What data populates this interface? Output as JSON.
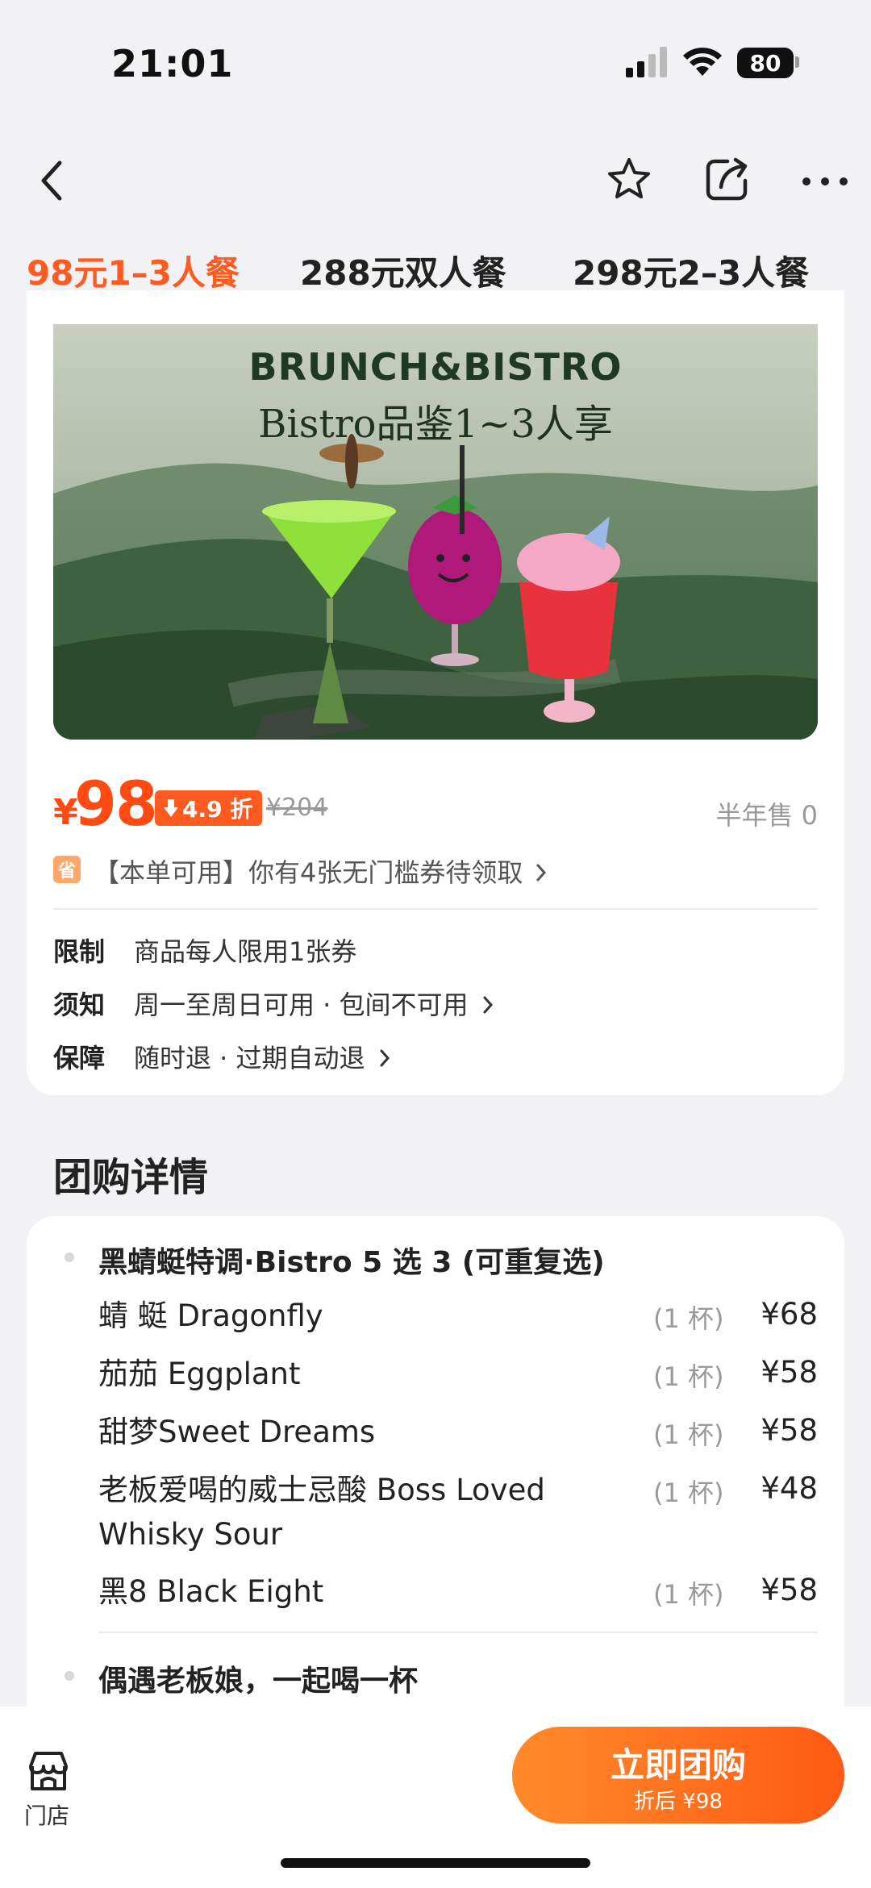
{
  "status_bar": {
    "time": "21:01",
    "battery": "80"
  },
  "tabs": [
    {
      "label": "98元1–3人餐",
      "active": true
    },
    {
      "label": "288元双人餐",
      "active": false
    },
    {
      "label": "298元2–3人餐",
      "active": false
    }
  ],
  "hero": {
    "title": "BRUNCH&BISTRO",
    "subtitle": "Bistro品鉴1~3人享"
  },
  "price": {
    "currency": "¥",
    "value": "98",
    "discount": "4.9 折",
    "original": "¥204",
    "sold": "半年售 0"
  },
  "coupon": {
    "icon": "省",
    "text": "【本单可用】你有4张无门槛券待领取"
  },
  "info": [
    {
      "label": "限制",
      "value": "商品每人限用1张券",
      "chevron": false
    },
    {
      "label": "须知",
      "value": "周一至周日可用 · 包间不可用",
      "chevron": true
    },
    {
      "label": "保障",
      "value": "随时退 · 过期自动退",
      "chevron": true
    }
  ],
  "section_title": "团购详情",
  "detail": {
    "group1_title": "黑蜻蜓特调·Bistro 5 选 3 (可重复选)",
    "items": [
      {
        "name": "蜻 蜓 Dragonfly",
        "qty": "(1 杯)",
        "price": "¥68"
      },
      {
        "name": "茄茄 Eggplant",
        "qty": "(1 杯)",
        "price": "¥58"
      },
      {
        "name": "甜梦Sweet Dreams",
        "qty": "(1 杯)",
        "price": "¥58"
      },
      {
        "name": "老板爱喝的威士忌酸 Boss Loved Whisky Sour",
        "qty": "(1 杯)",
        "price": "¥48"
      },
      {
        "name": "黑8 Black Eight",
        "qty": "(1 杯)",
        "price": "¥58"
      }
    ],
    "group2_title": "偶遇老板娘，一起喝一杯"
  },
  "bottom": {
    "store_label": "门店",
    "buy_label": "立即团购",
    "buy_sub": "折后 ¥98"
  },
  "colors": {
    "accent": "#ff5a1f",
    "price": "#ff4a12"
  }
}
